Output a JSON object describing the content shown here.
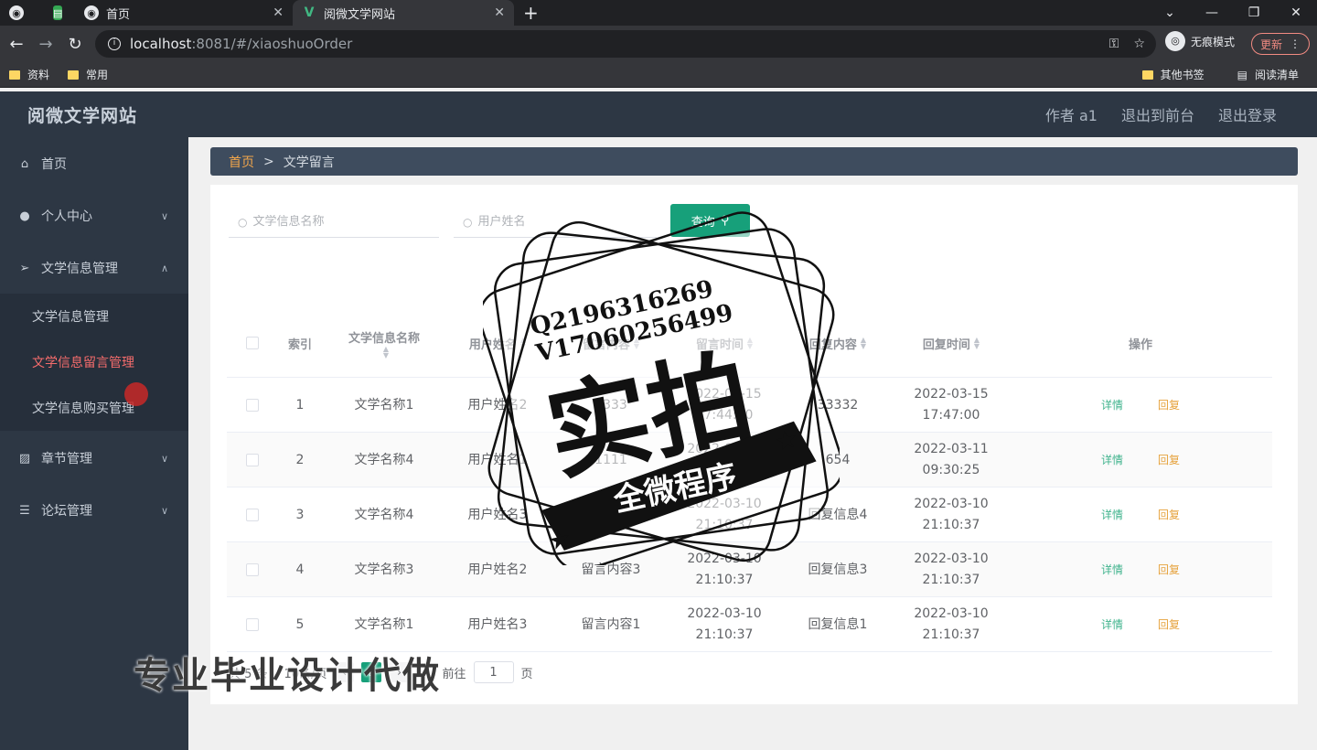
{
  "browser": {
    "tabs": [
      {
        "label": "首页",
        "active": false
      },
      {
        "label": "阅微文学网站",
        "active": true
      }
    ],
    "url_host": "localhost",
    "url_rest": ":8081/#/xiaoshuoOrder",
    "incognito_label": "无痕模式",
    "update_label": "更新",
    "bookmarks": [
      "资料",
      "常用"
    ],
    "bookmarks_right": [
      "其他书签",
      "阅读清单"
    ]
  },
  "header": {
    "title": "阅微文学网站",
    "author": "作者 a1",
    "exit_front": "退出到前台",
    "logout": "退出登录"
  },
  "sidebar": {
    "items": [
      {
        "label": "首页",
        "icon": "home-icon"
      },
      {
        "label": "个人中心",
        "icon": "user-icon"
      },
      {
        "label": "文学信息管理",
        "icon": "send-icon"
      },
      {
        "label": "章节管理",
        "icon": "chart-icon"
      },
      {
        "label": "论坛管理",
        "icon": "list-icon"
      }
    ],
    "subitems": [
      {
        "label": "文学信息管理",
        "active": false
      },
      {
        "label": "文学信息留言管理",
        "active": true
      },
      {
        "label": "文学信息购买管理",
        "active": false
      }
    ]
  },
  "breadcrumb": {
    "home": "首页",
    "current": "文学留言"
  },
  "search": {
    "title_placeholder": "文学信息名称",
    "user_placeholder": "用户姓名",
    "query_label": "查询"
  },
  "table": {
    "headers": [
      "索引",
      "文学信息名称",
      "用户姓名",
      "留言内容",
      "留言时间",
      "回复内容",
      "回复时间",
      "操作"
    ],
    "rows": [
      {
        "index": "1",
        "title": "文学名称1",
        "user": "用户姓名2",
        "content": "2333",
        "time": "2022-03-15 17:44:00",
        "reply": "33332",
        "reply_time": "2022-03-15 17:47:00"
      },
      {
        "index": "2",
        "title": "文学名称4",
        "user": "用户姓名1",
        "content": "1111",
        "time": "2022-03-11 09:24:25",
        "reply": "654",
        "reply_time": "2022-03-11 09:30:25"
      },
      {
        "index": "3",
        "title": "文学名称4",
        "user": "用户姓名3",
        "content": "留言内容4",
        "time": "2022-03-10 21:10:37",
        "reply": "回复信息4",
        "reply_time": "2022-03-10 21:10:37"
      },
      {
        "index": "4",
        "title": "文学名称3",
        "user": "用户姓名2",
        "content": "留言内容3",
        "time": "2022-03-10 21:10:37",
        "reply": "回复信息3",
        "reply_time": "2022-03-10 21:10:37"
      },
      {
        "index": "5",
        "title": "文学名称1",
        "user": "用户姓名3",
        "content": "留言内容1",
        "time": "2022-03-10 21:10:37",
        "reply": "回复信息1",
        "reply_time": "2022-03-10 21:10:37"
      }
    ],
    "detail_label": "详情",
    "reply_label": "回复"
  },
  "pager": {
    "total": "共 5 条",
    "per_page": "10条/页",
    "current": "1",
    "goto_prefix": "前往",
    "goto_value": "1",
    "goto_suffix": "页"
  },
  "watermark": {
    "qq": "Q2196316269",
    "wx": "V17060256499",
    "big": "实拍",
    "ribbon": "全微程序",
    "bottom": "专业毕业设计代做"
  }
}
